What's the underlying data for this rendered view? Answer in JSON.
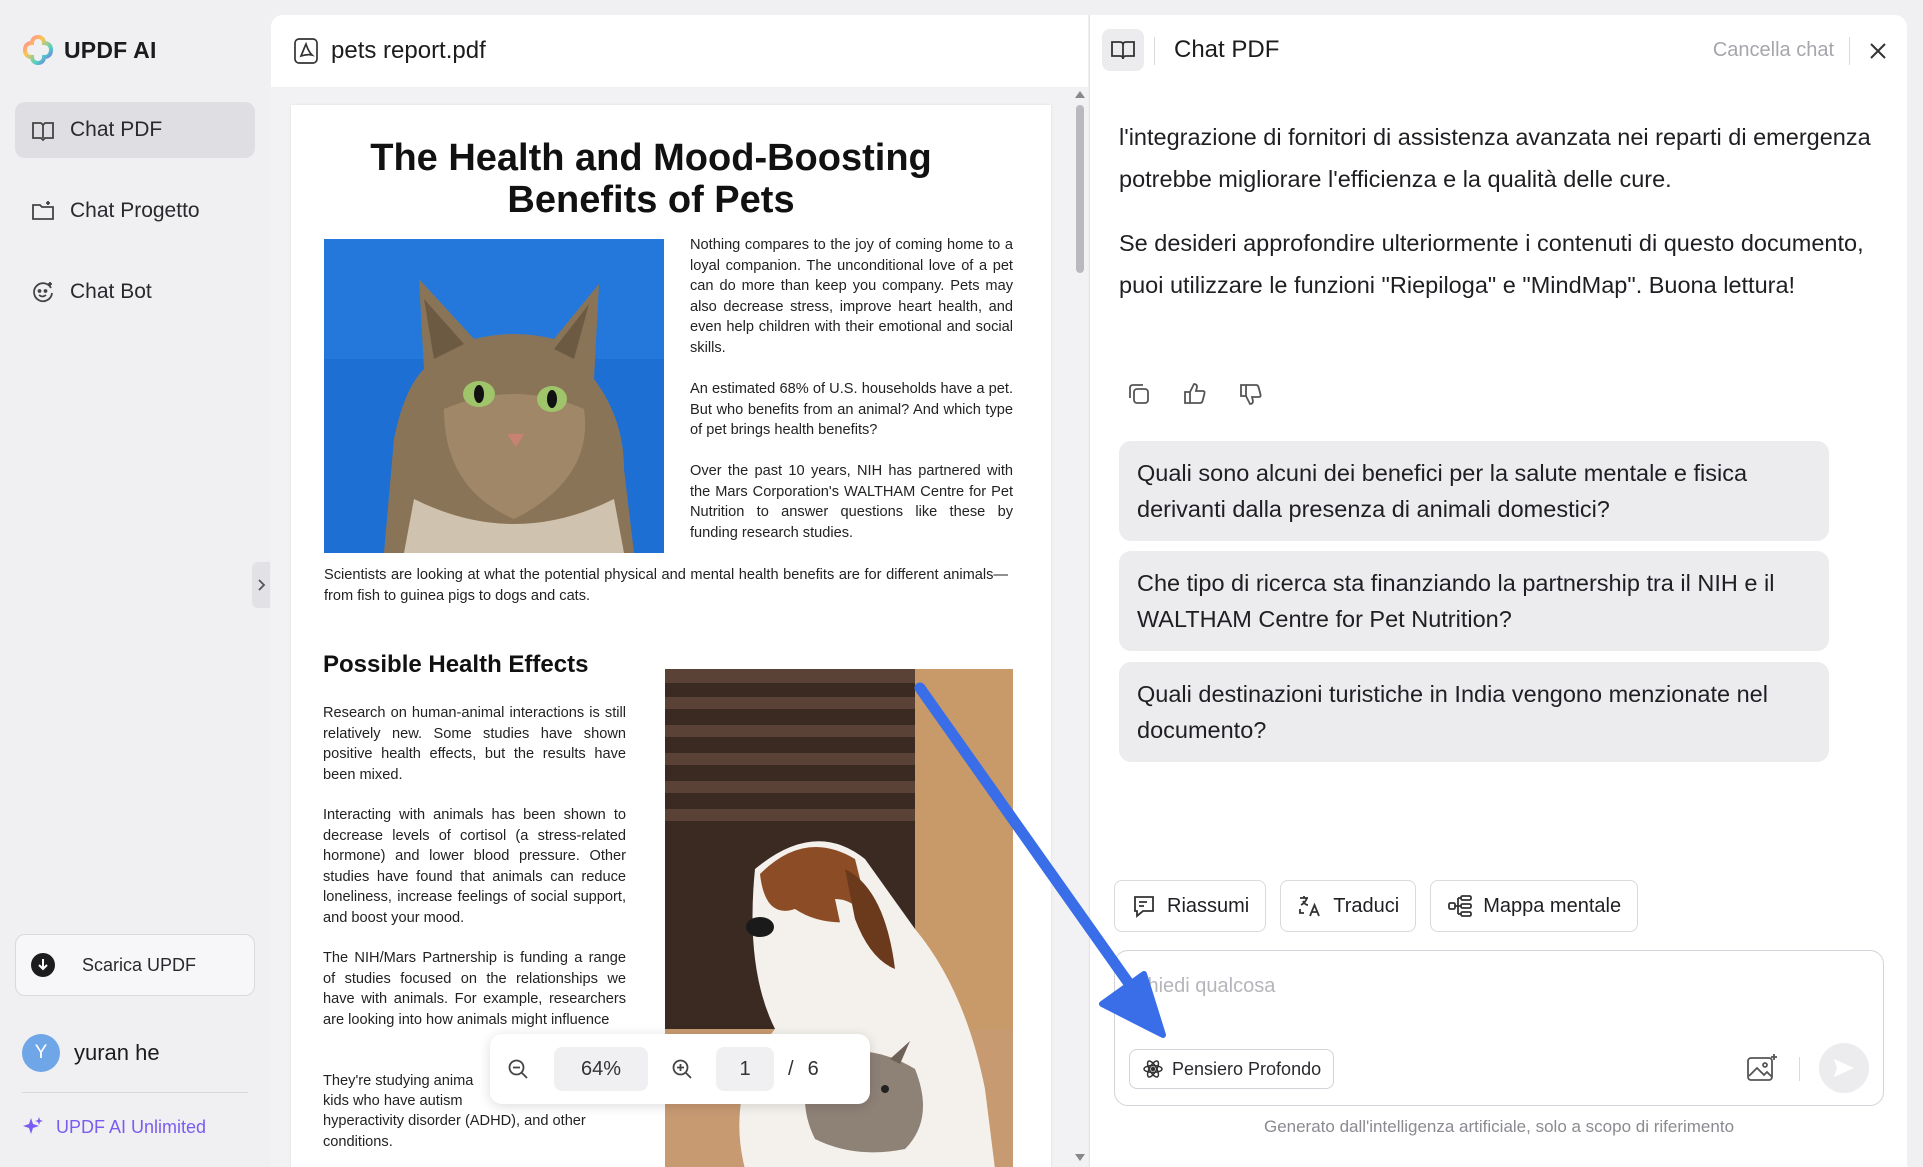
{
  "app": {
    "name": "UPDF AI"
  },
  "sidebar": {
    "items": [
      {
        "label": "Chat PDF",
        "icon": "book-chat-icon",
        "active": true
      },
      {
        "label": "Chat Progetto",
        "icon": "folder-chat-icon",
        "active": false
      },
      {
        "label": "Chat Bot",
        "icon": "bot-face-icon",
        "active": false
      }
    ],
    "download_label": "Scarica UPDF",
    "user": {
      "initial": "Y",
      "name": "yuran he"
    },
    "unlimited_label": "UPDF AI Unlimited"
  },
  "pdf": {
    "filename": "pets report.pdf",
    "page": {
      "title_line1": "The Health and Mood-Boosting",
      "title_line2": "Benefits of Pets",
      "para1": "Nothing compares to the joy of coming home to a loyal companion. The unconditional love of a pet can do more than keep you company. Pets may also decrease stress, improve heart health, and even help children with their emotional and social skills.",
      "para2": "An estimated 68% of U.S. households have a pet. But who benefits from an animal? And which type of pet brings health benefits?",
      "para3": "Over the past 10 years, NIH has partnered with the Mars Corporation's WALTHAM Centre for Pet Nutrition to answer questions like these by funding research studies.",
      "para4": "Scientists are looking at what the potential physical and mental health benefits are for different animals—from fish to guinea pigs to dogs and cats.",
      "heading2": "Possible Health Effects",
      "para5": "Research on human-animal interactions is still relatively new. Some studies have shown positive health effects, but the results have been mixed.",
      "para6": "Interacting with animals has been shown to decrease levels of cortisol (a stress-related hormone) and lower blood pressure. Other studies have found that animals can reduce loneliness, increase feelings of social support, and boost your mood.",
      "para7": "The NIH/Mars Partnership is funding a range of studies focused on the relationships we have with animals. For example, researchers are looking into how animals might influence",
      "para8": "They're studying anima",
      "para9": "kids who have autism",
      "para10": "hyperactivity disorder (ADHD), and other",
      "para11": "conditions."
    },
    "toolbar": {
      "zoom": "64%",
      "current_page": "1",
      "separator": "/",
      "total_pages": "6"
    }
  },
  "chat": {
    "title": "Chat PDF",
    "clear_label": "Cancella chat",
    "answer_p1": "l'integrazione di fornitori di assistenza avanzata nei reparti di emergenza potrebbe migliorare l'efficienza e la qualità delle cure.",
    "answer_p2": "Se desideri approfondire ulteriormente i contenuti di questo documento, puoi utilizzare le funzioni \"Riepiloga\" e \"MindMap\". Buona lettura!",
    "suggestions": [
      "Quali sono alcuni dei benefici per la salute mentale e fisica derivanti dalla presenza di animali domestici?",
      "Che tipo di ricerca sta finanziando la partnership tra il NIH e il WALTHAM Centre for Pet Nutrition?",
      "Quali destinazioni turistiche in India vengono menzionate nel documento?"
    ],
    "actions": [
      {
        "label": "Riassumi",
        "icon": "summarize-icon"
      },
      {
        "label": "Traduci",
        "icon": "translate-icon"
      },
      {
        "label": "Mappa mentale",
        "icon": "mindmap-icon"
      }
    ],
    "input_placeholder": "Chiedi qualcosa",
    "deep_thinking_label": "Pensiero Profondo",
    "disclaimer": "Generato dall'intelligenza artificiale, solo a scopo di riferimento"
  },
  "colors": {
    "accent_purple": "#7b5cf0",
    "arrow_blue": "#3a6ee8",
    "avatar_blue": "#6ea6e8"
  }
}
